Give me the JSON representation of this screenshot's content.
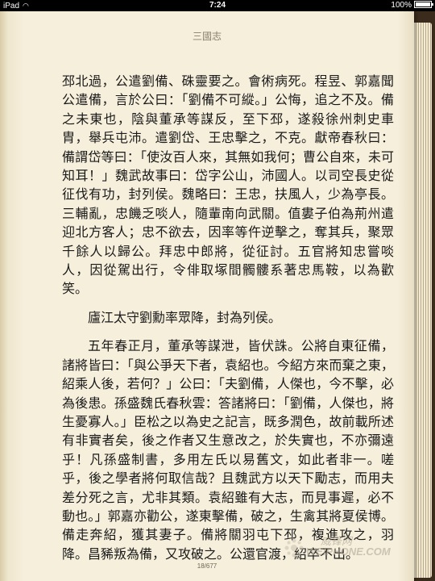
{
  "status_bar": {
    "device": "iPad",
    "time": "7:24",
    "battery": "100%",
    "battery_level": 1.0
  },
  "book": {
    "title": "三國志",
    "page_indicator": "18/677",
    "paragraphs": [
      {
        "indent": false,
        "text": "邳北過，公遣劉備、硃靈要之。會術病死。程昱、郭嘉聞公遣備，言於公曰：「劉備不可縱。」公悔，追之不及。備之未東也，陰與董承等謀反，至下邳，遂殺徐州刺史車胄，舉兵屯沛。遣劉岱、王忠擊之，不克。獻帝春秋曰：備謂岱等曰：「使汝百人來，其無如我何；曹公自來，未可知耳！」魏武故事曰：岱字公山，沛國人。以司空長史從征伐有功，封列侯。魏略曰：王忠，扶風人，少為亭長。三輔亂，忠饑乏啖人，隨輩南向武關。值婁子伯為荊州遣迎北方客人；忠不欲去，因率等仵逆擊之，奪其兵，聚眾千餘人以歸公。拜忠中郎將，從征討。五官將知忠嘗啖人，因從駕出行，令俳取塚間髑髏系著忠馬鞍，以為歡笑。"
      },
      {
        "indent": true,
        "text": "廬江太守劉勳率眾降，封為列侯。"
      },
      {
        "indent": true,
        "text": "五年春正月，董承等謀泄，皆伏誅。公將自東征備，諸將皆曰：「與公爭天下者，袁紹也。今紹方來而棄之東，紹乘人後，若何？」公曰：「夫劉備，人傑也，今不擊，必為後患。孫盛魏氏春秋雲：答諸將曰：「劉備，人傑也，將生憂寡人。」臣松之以為史之記言，既多潤色，故前載所述有非實者矣，後之作者又生意改之，於失實也，不亦彌遠乎！凡孫盛制書，多用左氏以易舊文，如此者非一。嗟乎，後之學者將何取信哉？且魏武方以天下勵志，而用夫差分死之言，尤非其類。袁紹雖有大志，而見事遲，必不動也。」郭嘉亦勸公，遂東擊備，破之，生禽其將夏侯博。備走奔紹，獲其妻子。備將關羽屯下邳，複進攻之，羽降。昌豨叛為備，又攻破之。公還官渡，紹卒不出。"
      }
    ]
  },
  "watermark": {
    "cn": "威锋网",
    "en": "WEIPHONE.COM"
  }
}
